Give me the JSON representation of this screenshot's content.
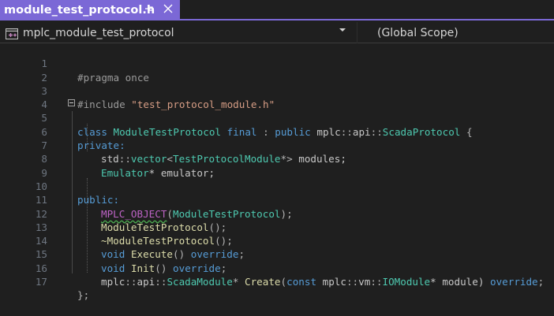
{
  "tab": {
    "title": "module_test_protocol.h",
    "pin_icon": "pin-icon",
    "close_icon": "close-icon"
  },
  "navbar": {
    "project": "mplc_module_test_protocol",
    "scope": "(Global Scope)",
    "project_icon": "cpp-project-icon",
    "dropdown_icon": "chevron-down-icon"
  },
  "code": {
    "line_numbers": [
      "1",
      "2",
      "3",
      "4",
      "5",
      "6",
      "7",
      "8",
      "9",
      "10",
      "11",
      "12",
      "13",
      "14",
      "15",
      "16",
      "17"
    ],
    "line1": "#pragma once",
    "line3_directive": "#include ",
    "line3_string": "\"test_protocol_module.h\"",
    "line5": {
      "kw1": "class",
      "name": "ModuleTestProtocol",
      "kw2": "final",
      "colon": " : ",
      "kw3": "public",
      "ns1": "mplc",
      "sep1": "::",
      "ns2": "api",
      "sep2": "::",
      "base": "ScadaProtocol",
      "brace": " {"
    },
    "line6": "private:",
    "line7": {
      "ns": "std",
      "sep": "::",
      "type": "vector",
      "open": "<",
      "param": "TestProtocolModule",
      "close": "*> ",
      "var": "modules;"
    },
    "line8": {
      "type": "Emulator",
      "rest": "* emulator;"
    },
    "line10": "public:",
    "line11": {
      "macro": "MPLC_OBJECT",
      "open": "(",
      "arg": "ModuleTestProtocol",
      "close": ");"
    },
    "line12": {
      "fn": "ModuleTestProtocol",
      "rest": "();"
    },
    "line13": {
      "fn": "~ModuleTestProtocol",
      "rest": "();"
    },
    "line14": {
      "kw": "void",
      "fn": "Execute",
      "mid": "() ",
      "kw2": "override",
      "end": ";"
    },
    "line15": {
      "kw": "void",
      "fn": "Init",
      "mid": "() ",
      "kw2": "override",
      "end": ";"
    },
    "line16": {
      "ns1": "mplc",
      "sep1": "::",
      "ns2": "api",
      "sep2": "::",
      "type": "ScadaModule",
      "star": "* ",
      "fn": "Create",
      "open": "(",
      "kw": "const",
      "sp": " ",
      "ns3": "mplc",
      "sep3": "::",
      "ns4": "vm",
      "sep4": "::",
      "type2": "IOModule",
      "param": "* module) ",
      "kw2": "override",
      "end": ";"
    },
    "line17": "};"
  },
  "colors": {
    "accent": "#7b68d6",
    "background": "#1f1f1f",
    "keyword": "#569cd6",
    "type": "#4ec9b0",
    "function": "#dcdcaa",
    "string": "#d69d85",
    "macro": "#bd63c5"
  }
}
